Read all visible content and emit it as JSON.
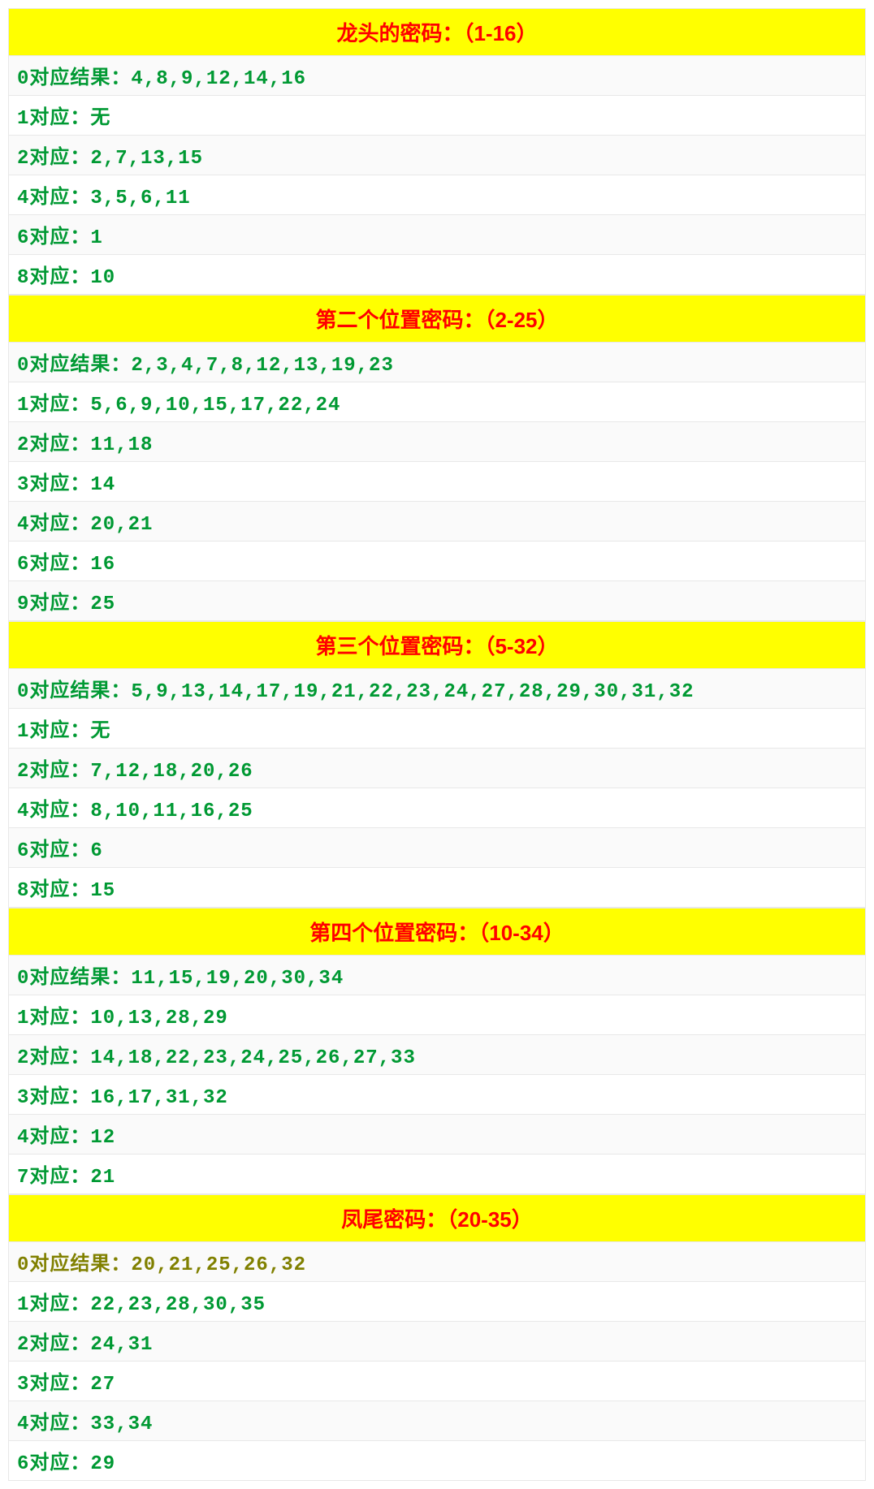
{
  "sections": [
    {
      "title": "龙头的密码：（1-16）",
      "rows": [
        "0对应结果：4,8,9,12,14,16",
        "1对应：无",
        "2对应：2,7,13,15",
        "4对应：3,5,6,11",
        "6对应：1",
        "8对应：10"
      ]
    },
    {
      "title": "第二个位置密码：（2-25）",
      "rows": [
        "0对应结果：2,3,4,7,8,12,13,19,23",
        "1对应：5,6,9,10,15,17,22,24",
        "2对应：11,18",
        "3对应：14",
        "4对应：20,21",
        "6对应：16",
        "9对应：25"
      ]
    },
    {
      "title": "第三个位置密码：（5-32）",
      "rows": [
        "0对应结果：5,9,13,14,17,19,21,22,23,24,27,28,29,30,31,32",
        "1对应：无",
        "2对应：7,12,18,20,26",
        "4对应：8,10,11,16,25",
        "6对应：6",
        "8对应：15"
      ]
    },
    {
      "title": "第四个位置密码：（10-34）",
      "rows": [
        "0对应结果：11,15,19,20,30,34",
        "1对应：10,13,28,29",
        "2对应：14,18,22,23,24,25,26,27,33",
        "3对应：16,17,31,32",
        "4对应：12",
        "7对应：21"
      ]
    },
    {
      "title": "凤尾密码：（20-35）",
      "rows": [
        "0对应结果：20,21,25,26,32",
        "1对应：22,23,28,30,35",
        "2对应：24,31",
        "3对应：27",
        "4对应：33,34",
        "6对应：29"
      ],
      "firstRowOlive": true
    }
  ]
}
